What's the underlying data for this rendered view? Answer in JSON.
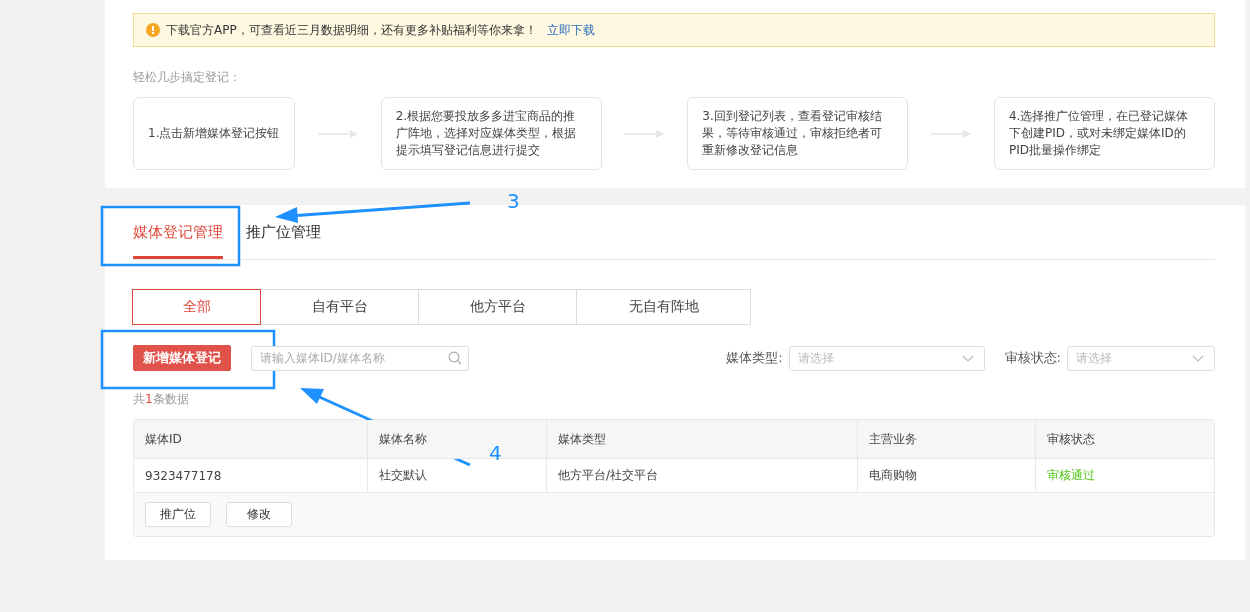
{
  "notice": {
    "text": "下载官方APP，可查看近三月数据明细，还有更多补贴福利等你来拿！",
    "link": "立即下载"
  },
  "steps_title": "轻松几步搞定登记：",
  "steps": [
    "1.点击新增媒体登记按钮",
    "2.根据您要投放多多进宝商品的推广阵地，选择对应媒体类型，根据提示填写登记信息进行提交",
    "3.回到登记列表，查看登记审核结果，等待审核通过，审核拒绝者可重新修改登记信息",
    "4.选择推广位管理，在已登记媒体下创建PID，或对未绑定媒体ID的PID批量操作绑定"
  ],
  "tabs": [
    {
      "label": "媒体登记管理",
      "selected": true
    },
    {
      "label": "推广位管理",
      "selected": false
    }
  ],
  "filter_tabs": [
    {
      "label": "全部",
      "selected": true
    },
    {
      "label": "自有平台",
      "selected": false
    },
    {
      "label": "他方平台",
      "selected": false
    },
    {
      "label": "无自有阵地",
      "selected": false
    }
  ],
  "add_button": "新增媒体登记",
  "search": {
    "placeholder": "请输入媒体ID/媒体名称"
  },
  "filters": [
    {
      "label": "媒体类型:",
      "placeholder": "请选择"
    },
    {
      "label": "审核状态:",
      "placeholder": "请选择"
    }
  ],
  "count": {
    "prefix": "共",
    "number": "1",
    "suffix": "条数据"
  },
  "table": {
    "columns": [
      "媒体ID",
      "媒体名称",
      "媒体类型",
      "主营业务",
      "审核状态"
    ],
    "rows": [
      {
        "cells": [
          "9323477178",
          "社交默认",
          "他方平台/社交平台",
          "电商购物"
        ],
        "status": {
          "text": "审核通过",
          "kind": "approved"
        },
        "actions": [
          "推广位",
          "修改"
        ]
      }
    ]
  },
  "annotations": [
    {
      "label": "3"
    },
    {
      "label": "4"
    }
  ]
}
